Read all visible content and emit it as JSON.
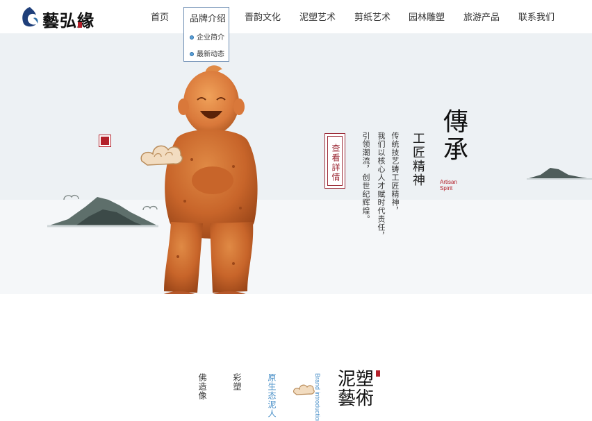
{
  "logo": {
    "text": "藝弘緣",
    "icon": "wave-logo-icon"
  },
  "nav": {
    "items": [
      {
        "label": "首页"
      },
      {
        "label": "品牌介绍"
      },
      {
        "label": "晋韵文化"
      },
      {
        "label": "泥塑艺术"
      },
      {
        "label": "剪纸艺术"
      },
      {
        "label": "园林雕塑"
      },
      {
        "label": "旅游产品"
      },
      {
        "label": "联系我们"
      }
    ],
    "dropdown": {
      "items": [
        "企业简介",
        "最新动态"
      ]
    }
  },
  "banner": {
    "cta_label": "查看詳情",
    "big_title": "傳承",
    "subtitle": "工匠精神",
    "en_subtitle_line1": "Artisan",
    "en_subtitle_line2": "Spirit",
    "desc_lines": [
      "传统技艺铸工匠精神，",
      "我们以核心人才赋时代责任，",
      "引领潮流，创世纪辉煌。"
    ]
  },
  "bottom": {
    "categories": [
      "佛造像",
      "彩塑",
      "原生态泥人"
    ],
    "brand_en": "Brand introduction",
    "brand_cn": "泥塑藝術"
  },
  "colors": {
    "accent_red": "#b3202a",
    "accent_blue": "#4a90c8",
    "clay": "#c8652a"
  }
}
